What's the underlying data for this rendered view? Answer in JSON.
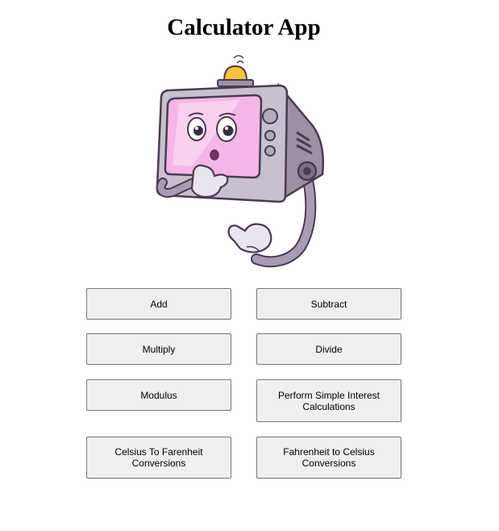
{
  "page": {
    "title": "Calculator App"
  },
  "buttons": {
    "add": "Add",
    "subtract": "Subtract",
    "multiply": "Multiply",
    "divide": "Divide",
    "modulus": "Modulus",
    "simple_interest": "Perform Simple Interest Calculations",
    "c_to_f": "Celsius To Farenheit Conversions",
    "f_to_c": "Fahrenheit to Celsius Conversions"
  },
  "illustration": {
    "icon": "retro-tv-robot-mascot-icon",
    "colors": {
      "body": "#b9b3c2",
      "screen": "#f4b6e6",
      "outline": "#4a3a52",
      "lamp": "#f6c33a"
    }
  }
}
